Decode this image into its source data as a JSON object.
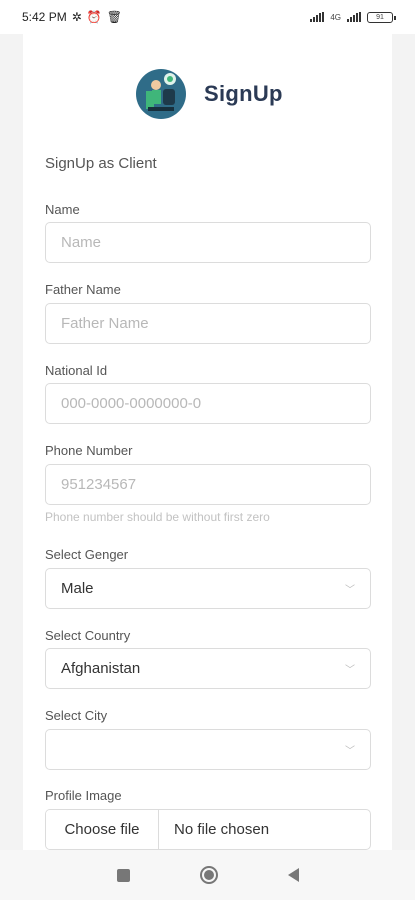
{
  "status_bar": {
    "time": "5:42 PM",
    "network_label": "4G",
    "battery": "91"
  },
  "header": {
    "title": "SignUp"
  },
  "form": {
    "heading": "SignUp as Client",
    "name": {
      "label": "Name",
      "placeholder": "Name",
      "value": ""
    },
    "father_name": {
      "label": "Father Name",
      "placeholder": "Father Name",
      "value": ""
    },
    "national_id": {
      "label": "National Id",
      "placeholder": "000-0000-0000000-0",
      "value": ""
    },
    "phone": {
      "label": "Phone Number",
      "placeholder": "951234567",
      "value": "",
      "hint": "Phone number should be without first zero"
    },
    "gender": {
      "label": "Select Genger",
      "selected": "Male"
    },
    "country": {
      "label": "Select Country",
      "selected": "Afghanistan"
    },
    "city": {
      "label": "Select City",
      "selected": ""
    },
    "profile_image": {
      "label": "Profile Image",
      "button": "Choose file",
      "status": "No file chosen"
    }
  },
  "icons": {
    "status": [
      "settings-icon",
      "alarm-icon",
      "delete-icon",
      "signal-icon",
      "battery-icon"
    ],
    "nav": [
      "recent-apps-icon",
      "home-icon",
      "back-icon"
    ],
    "select": "chevron-down-icon"
  },
  "colors": {
    "brand_text": "#2b3a55",
    "logo_bg": "#2f6c88",
    "input_border": "#dcdcdc",
    "placeholder": "#b8b8b8"
  }
}
